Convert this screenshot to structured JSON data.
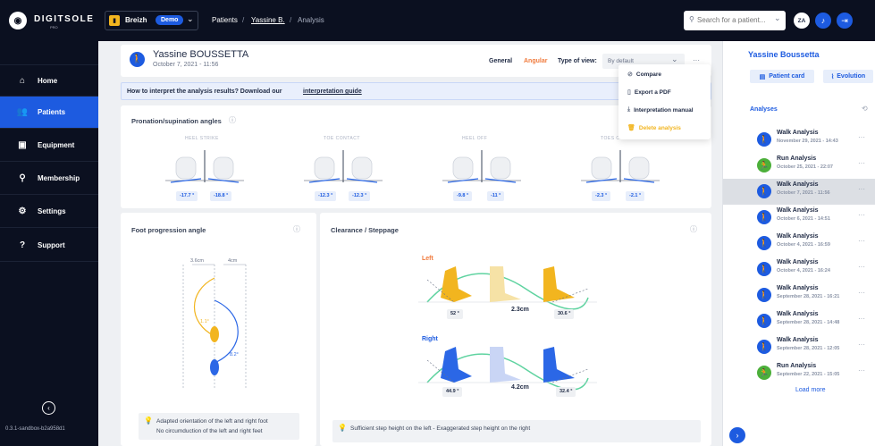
{
  "top": {
    "brand": "DIGITSOLE",
    "brand_sub": "PRO",
    "workspace": "Breizh",
    "badge": "Demo",
    "crumbs": [
      "Patients",
      "Yassine B.",
      "Analysis"
    ],
    "search_placeholder": "Search for a patient...",
    "avatar": "ZA"
  },
  "nav": {
    "items": [
      "Home",
      "Patients",
      "Equipment",
      "Membership",
      "Settings",
      "Support"
    ],
    "version": "0.3.1-sandbox-b2a958d1"
  },
  "header": {
    "name": "Yassine BOUSSETTA",
    "date": "October 7, 2021 - 11:56",
    "tab_general": "General",
    "tab_angular": "Angular",
    "view_label": "Type of view:",
    "view_value": "By default",
    "more": "···"
  },
  "menu": {
    "items": [
      "Compare",
      "Export a PDF",
      "Interpretation manual",
      "Delete analysis"
    ]
  },
  "banner": {
    "text": "How to interpret the analysis results? Download our ",
    "link": "interpretation guide"
  },
  "pronation": {
    "title": "Pronation/supination angles",
    "phases": [
      {
        "label": "HEEL STRIKE",
        "left": "-17.7 °",
        "right": "-18.8 °"
      },
      {
        "label": "TOE CONTACT",
        "left": "-12.3 °",
        "right": "-12.3 °"
      },
      {
        "label": "HEEL OFF",
        "left": "-9.8 °",
        "right": "-11 °"
      },
      {
        "label": "TOES OFF",
        "left": "-2.3 °",
        "right": "-2.1 °"
      }
    ]
  },
  "progression": {
    "title": "Foot progression angle",
    "w_left": "3.6cm",
    "w_right": "4cm",
    "a_left": "1.1°",
    "a_right": "8.2°",
    "note1": "Adapted orientation of the left and right foot",
    "note2": "No circumduction of the left and right feet"
  },
  "clearance": {
    "title": "Clearance / Steppage",
    "left_label": "Left",
    "right_label": "Right",
    "left_a1": "52 °",
    "left_h": "2.3cm",
    "left_a2": "30.6 °",
    "right_a1": "44.9 °",
    "right_h": "4.2cm",
    "right_a2": "32.4 °",
    "note": "Sufficient step height on the left - Exaggerated step height on the right"
  },
  "panel": {
    "name": "Yassine Boussetta",
    "patient_card": "Patient card",
    "evolution": "Evolution",
    "analyses_title": "Analyses",
    "load_more": "Load more",
    "analyses": [
      {
        "type": "Walk Analysis",
        "date": "November 29, 2021 - 14:43",
        "kind": "walk"
      },
      {
        "type": "Run Analysis",
        "date": "October 25, 2021 - 22:07",
        "kind": "run"
      },
      {
        "type": "Walk Analysis",
        "date": "October 7, 2021 - 11:56",
        "kind": "walk"
      },
      {
        "type": "Walk Analysis",
        "date": "October 6, 2021 - 14:51",
        "kind": "walk"
      },
      {
        "type": "Walk Analysis",
        "date": "October 4, 2021 - 16:59",
        "kind": "walk"
      },
      {
        "type": "Walk Analysis",
        "date": "October 4, 2021 - 16:24",
        "kind": "walk"
      },
      {
        "type": "Walk Analysis",
        "date": "September 28, 2021 - 16:21",
        "kind": "walk"
      },
      {
        "type": "Walk Analysis",
        "date": "September 28, 2021 - 14:48",
        "kind": "walk"
      },
      {
        "type": "Walk Analysis",
        "date": "September 28, 2021 - 12:05",
        "kind": "walk"
      },
      {
        "type": "Run Analysis",
        "date": "September 22, 2021 - 15:05",
        "kind": "run"
      }
    ]
  },
  "colors": {
    "accent": "#1d5be0",
    "sidebar": "#0b1020",
    "walk": "#1d5be0",
    "run": "#4caf3a",
    "orange": "#f07a3c",
    "yellow": "#f2b51f",
    "blue": "#2b67e6",
    "green": "#5fd3a0"
  }
}
